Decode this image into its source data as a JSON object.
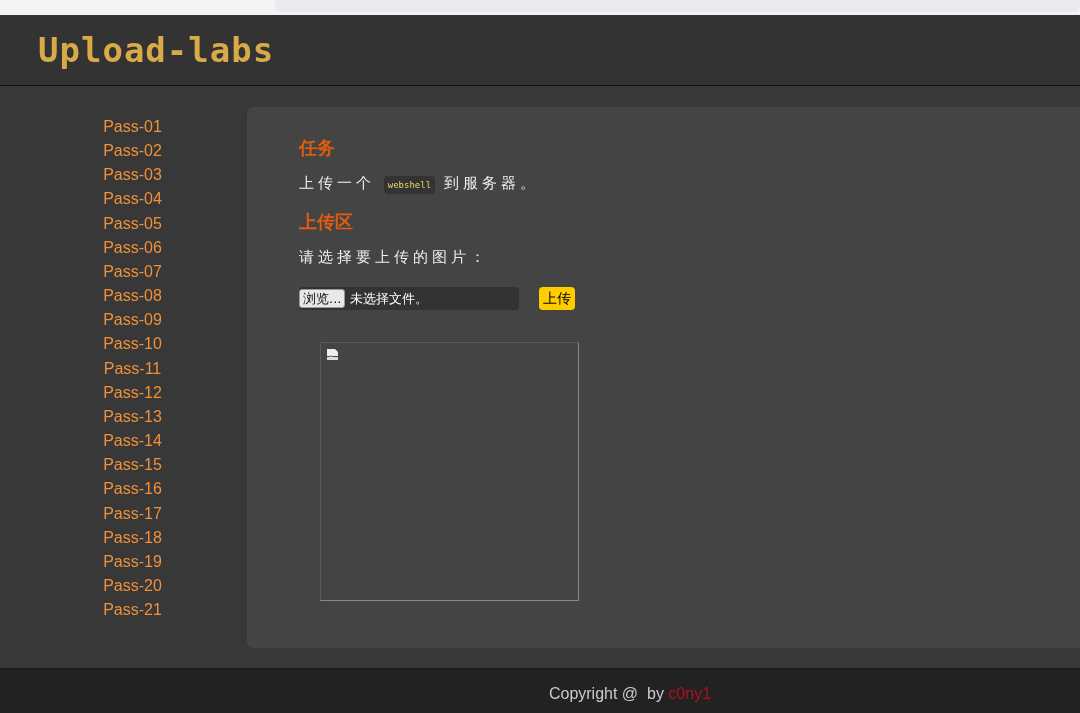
{
  "logo": "Upload-labs",
  "sidebar": {
    "items": [
      {
        "label": "Pass-01"
      },
      {
        "label": "Pass-02"
      },
      {
        "label": "Pass-03"
      },
      {
        "label": "Pass-04"
      },
      {
        "label": "Pass-05"
      },
      {
        "label": "Pass-06"
      },
      {
        "label": "Pass-07"
      },
      {
        "label": "Pass-08"
      },
      {
        "label": "Pass-09"
      },
      {
        "label": "Pass-10"
      },
      {
        "label": "Pass-11"
      },
      {
        "label": "Pass-12"
      },
      {
        "label": "Pass-13"
      },
      {
        "label": "Pass-14"
      },
      {
        "label": "Pass-15"
      },
      {
        "label": "Pass-16"
      },
      {
        "label": "Pass-17"
      },
      {
        "label": "Pass-18"
      },
      {
        "label": "Pass-19"
      },
      {
        "label": "Pass-20"
      },
      {
        "label": "Pass-21"
      }
    ]
  },
  "task": {
    "heading": "任务",
    "text_before": "上传一个",
    "code": "webshell",
    "text_after": "到服务器。"
  },
  "upload": {
    "heading": "上传区",
    "prompt": "请选择要上传的图片：",
    "browse_button": "浏览...",
    "file_status": "未选择文件。",
    "submit_button": "上传"
  },
  "footer": {
    "copyright": "Copyright @",
    "by": "by",
    "author": "c0ny1"
  }
}
